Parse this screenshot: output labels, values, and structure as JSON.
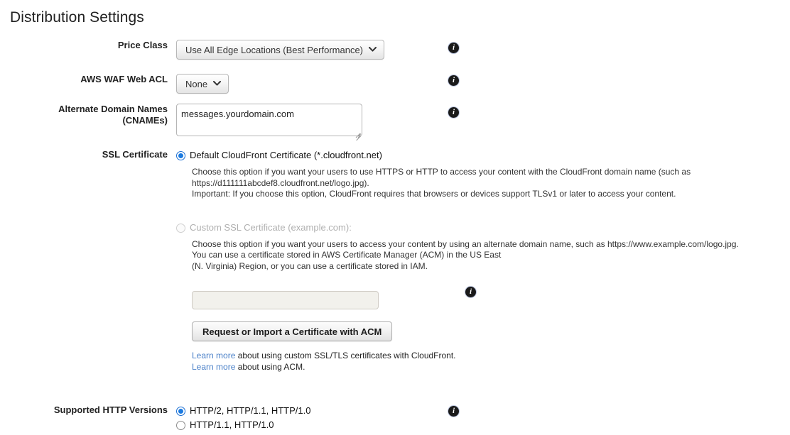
{
  "page": {
    "title": "Distribution Settings"
  },
  "fields": {
    "price_class": {
      "label": "Price Class",
      "value": "Use All Edge Locations (Best Performance)",
      "caret": "⌄",
      "info": "i"
    },
    "waf_acl": {
      "label": "AWS WAF Web ACL",
      "value": "None",
      "caret": "⌄",
      "info": "i"
    },
    "cnames": {
      "label_line1": "Alternate Domain Names",
      "label_line2": "(CNAMEs)",
      "value": "messages.yourdomain.com",
      "placeholder": "",
      "info": "i"
    },
    "ssl_certificate": {
      "label": "SSL Certificate",
      "options": [
        {
          "id": "default-cloudfront",
          "label": "Default CloudFront Certificate (*.cloudfront.net)",
          "selected": true,
          "disabled": false,
          "description": [
            "Choose this option if you want your users to use HTTPS or HTTP to access your content with the CloudFront domain name (such as",
            "https://d111111abcdef8.cloudfront.net/logo.jpg).",
            "Important: If you choose this option, CloudFront requires that browsers or devices support TLSv1 or later to access your content."
          ]
        },
        {
          "id": "custom-ssl",
          "label": "Custom SSL Certificate (example.com):",
          "selected": false,
          "disabled": true,
          "description": [
            "Choose this option if you want your users to access your content by using an alternate domain name, such as https://www.example.com/logo.jpg.",
            "You can use a certificate stored in AWS Certificate Manager (ACM) in the US East",
            "(N. Virginia) Region, or you can use a certificate stored in IAM."
          ]
        }
      ],
      "certificate_input": {
        "value": "",
        "placeholder": "",
        "disabled": true,
        "info": "i"
      },
      "acm_button": "Request or Import a Certificate with ACM",
      "links": [
        {
          "link_text": "Learn more",
          "rest": " about using custom SSL/TLS certificates with CloudFront."
        },
        {
          "link_text": "Learn more",
          "rest": " about using ACM."
        }
      ]
    },
    "http_versions": {
      "label": "Supported HTTP Versions",
      "options": [
        {
          "label": "HTTP/2, HTTP/1.1, HTTP/1.0",
          "selected": true
        },
        {
          "label": "HTTP/1.1, HTTP/1.0",
          "selected": false
        }
      ],
      "info": "i"
    }
  },
  "colors": {
    "link": "#4a80c8",
    "radio_selected": "#1b7ae0",
    "label_text": "#222222",
    "disabled_text": "#b0b0b0"
  }
}
